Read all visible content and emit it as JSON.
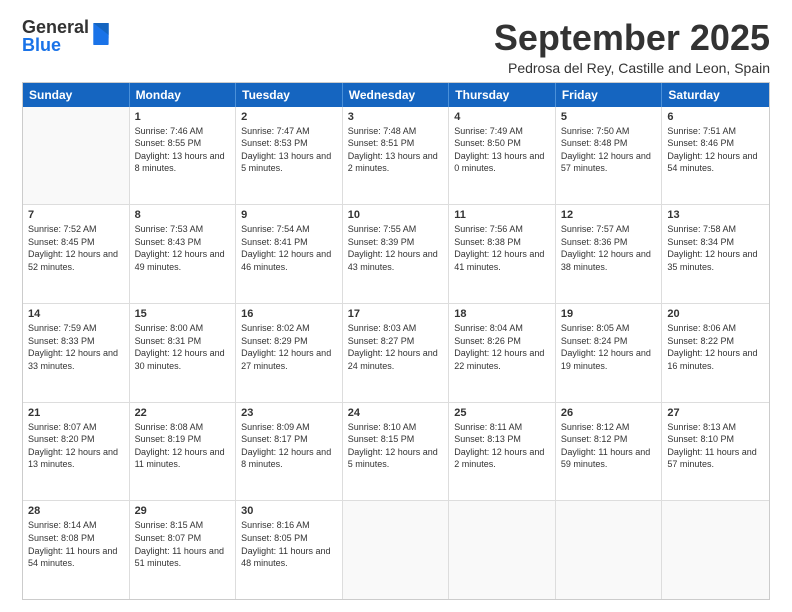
{
  "header": {
    "logo": {
      "line1": "General",
      "line2": "Blue"
    },
    "month": "September 2025",
    "location": "Pedrosa del Rey, Castille and Leon, Spain"
  },
  "days_of_week": [
    "Sunday",
    "Monday",
    "Tuesday",
    "Wednesday",
    "Thursday",
    "Friday",
    "Saturday"
  ],
  "weeks": [
    [
      {
        "day": "",
        "sunrise": "",
        "sunset": "",
        "daylight": ""
      },
      {
        "day": "1",
        "sunrise": "Sunrise: 7:46 AM",
        "sunset": "Sunset: 8:55 PM",
        "daylight": "Daylight: 13 hours and 8 minutes."
      },
      {
        "day": "2",
        "sunrise": "Sunrise: 7:47 AM",
        "sunset": "Sunset: 8:53 PM",
        "daylight": "Daylight: 13 hours and 5 minutes."
      },
      {
        "day": "3",
        "sunrise": "Sunrise: 7:48 AM",
        "sunset": "Sunset: 8:51 PM",
        "daylight": "Daylight: 13 hours and 2 minutes."
      },
      {
        "day": "4",
        "sunrise": "Sunrise: 7:49 AM",
        "sunset": "Sunset: 8:50 PM",
        "daylight": "Daylight: 13 hours and 0 minutes."
      },
      {
        "day": "5",
        "sunrise": "Sunrise: 7:50 AM",
        "sunset": "Sunset: 8:48 PM",
        "daylight": "Daylight: 12 hours and 57 minutes."
      },
      {
        "day": "6",
        "sunrise": "Sunrise: 7:51 AM",
        "sunset": "Sunset: 8:46 PM",
        "daylight": "Daylight: 12 hours and 54 minutes."
      }
    ],
    [
      {
        "day": "7",
        "sunrise": "Sunrise: 7:52 AM",
        "sunset": "Sunset: 8:45 PM",
        "daylight": "Daylight: 12 hours and 52 minutes."
      },
      {
        "day": "8",
        "sunrise": "Sunrise: 7:53 AM",
        "sunset": "Sunset: 8:43 PM",
        "daylight": "Daylight: 12 hours and 49 minutes."
      },
      {
        "day": "9",
        "sunrise": "Sunrise: 7:54 AM",
        "sunset": "Sunset: 8:41 PM",
        "daylight": "Daylight: 12 hours and 46 minutes."
      },
      {
        "day": "10",
        "sunrise": "Sunrise: 7:55 AM",
        "sunset": "Sunset: 8:39 PM",
        "daylight": "Daylight: 12 hours and 43 minutes."
      },
      {
        "day": "11",
        "sunrise": "Sunrise: 7:56 AM",
        "sunset": "Sunset: 8:38 PM",
        "daylight": "Daylight: 12 hours and 41 minutes."
      },
      {
        "day": "12",
        "sunrise": "Sunrise: 7:57 AM",
        "sunset": "Sunset: 8:36 PM",
        "daylight": "Daylight: 12 hours and 38 minutes."
      },
      {
        "day": "13",
        "sunrise": "Sunrise: 7:58 AM",
        "sunset": "Sunset: 8:34 PM",
        "daylight": "Daylight: 12 hours and 35 minutes."
      }
    ],
    [
      {
        "day": "14",
        "sunrise": "Sunrise: 7:59 AM",
        "sunset": "Sunset: 8:33 PM",
        "daylight": "Daylight: 12 hours and 33 minutes."
      },
      {
        "day": "15",
        "sunrise": "Sunrise: 8:00 AM",
        "sunset": "Sunset: 8:31 PM",
        "daylight": "Daylight: 12 hours and 30 minutes."
      },
      {
        "day": "16",
        "sunrise": "Sunrise: 8:02 AM",
        "sunset": "Sunset: 8:29 PM",
        "daylight": "Daylight: 12 hours and 27 minutes."
      },
      {
        "day": "17",
        "sunrise": "Sunrise: 8:03 AM",
        "sunset": "Sunset: 8:27 PM",
        "daylight": "Daylight: 12 hours and 24 minutes."
      },
      {
        "day": "18",
        "sunrise": "Sunrise: 8:04 AM",
        "sunset": "Sunset: 8:26 PM",
        "daylight": "Daylight: 12 hours and 22 minutes."
      },
      {
        "day": "19",
        "sunrise": "Sunrise: 8:05 AM",
        "sunset": "Sunset: 8:24 PM",
        "daylight": "Daylight: 12 hours and 19 minutes."
      },
      {
        "day": "20",
        "sunrise": "Sunrise: 8:06 AM",
        "sunset": "Sunset: 8:22 PM",
        "daylight": "Daylight: 12 hours and 16 minutes."
      }
    ],
    [
      {
        "day": "21",
        "sunrise": "Sunrise: 8:07 AM",
        "sunset": "Sunset: 8:20 PM",
        "daylight": "Daylight: 12 hours and 13 minutes."
      },
      {
        "day": "22",
        "sunrise": "Sunrise: 8:08 AM",
        "sunset": "Sunset: 8:19 PM",
        "daylight": "Daylight: 12 hours and 11 minutes."
      },
      {
        "day": "23",
        "sunrise": "Sunrise: 8:09 AM",
        "sunset": "Sunset: 8:17 PM",
        "daylight": "Daylight: 12 hours and 8 minutes."
      },
      {
        "day": "24",
        "sunrise": "Sunrise: 8:10 AM",
        "sunset": "Sunset: 8:15 PM",
        "daylight": "Daylight: 12 hours and 5 minutes."
      },
      {
        "day": "25",
        "sunrise": "Sunrise: 8:11 AM",
        "sunset": "Sunset: 8:13 PM",
        "daylight": "Daylight: 12 hours and 2 minutes."
      },
      {
        "day": "26",
        "sunrise": "Sunrise: 8:12 AM",
        "sunset": "Sunset: 8:12 PM",
        "daylight": "Daylight: 11 hours and 59 minutes."
      },
      {
        "day": "27",
        "sunrise": "Sunrise: 8:13 AM",
        "sunset": "Sunset: 8:10 PM",
        "daylight": "Daylight: 11 hours and 57 minutes."
      }
    ],
    [
      {
        "day": "28",
        "sunrise": "Sunrise: 8:14 AM",
        "sunset": "Sunset: 8:08 PM",
        "daylight": "Daylight: 11 hours and 54 minutes."
      },
      {
        "day": "29",
        "sunrise": "Sunrise: 8:15 AM",
        "sunset": "Sunset: 8:07 PM",
        "daylight": "Daylight: 11 hours and 51 minutes."
      },
      {
        "day": "30",
        "sunrise": "Sunrise: 8:16 AM",
        "sunset": "Sunset: 8:05 PM",
        "daylight": "Daylight: 11 hours and 48 minutes."
      },
      {
        "day": "",
        "sunrise": "",
        "sunset": "",
        "daylight": ""
      },
      {
        "day": "",
        "sunrise": "",
        "sunset": "",
        "daylight": ""
      },
      {
        "day": "",
        "sunrise": "",
        "sunset": "",
        "daylight": ""
      },
      {
        "day": "",
        "sunrise": "",
        "sunset": "",
        "daylight": ""
      }
    ]
  ]
}
